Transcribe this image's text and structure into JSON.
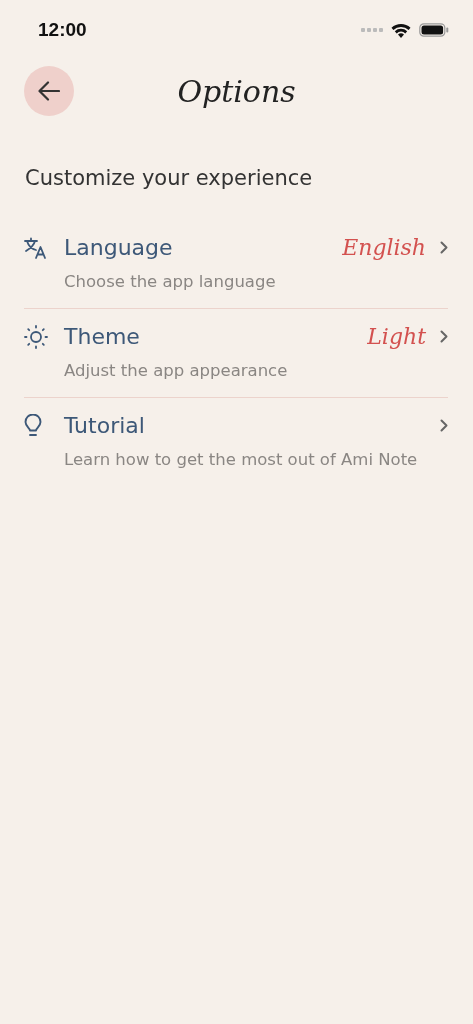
{
  "status_bar": {
    "time": "12:00"
  },
  "header": {
    "title": "Options"
  },
  "intro": "Customize your experience",
  "options": [
    {
      "kind": "language",
      "title": "Language",
      "value": "English",
      "description": "Choose the app language"
    },
    {
      "kind": "theme",
      "title": "Theme",
      "value": "Light",
      "description": "Adjust the app appearance"
    },
    {
      "kind": "tutorial",
      "title": "Tutorial",
      "description": "Learn how to get the most out of Ami Note"
    }
  ]
}
